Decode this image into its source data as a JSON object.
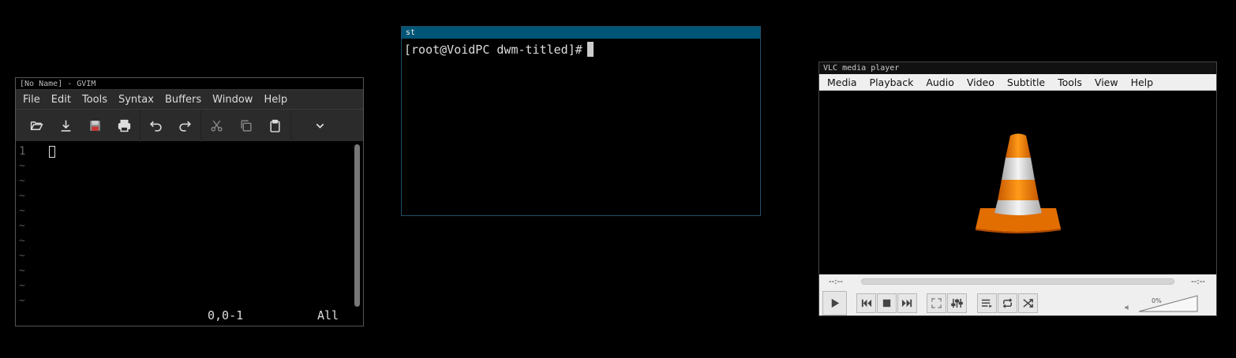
{
  "gvim": {
    "title": "[No Name] - GVIM",
    "menu": [
      "File",
      "Edit",
      "Tools",
      "Syntax",
      "Buffers",
      "Window",
      "Help"
    ],
    "line_number": "1",
    "tilde": "~",
    "position": "0,0-1",
    "scroll_label": "All"
  },
  "st": {
    "title": "st",
    "prompt": "[root@VoidPC dwm-titled]#"
  },
  "vlc": {
    "title": "VLC media player",
    "menu": [
      "Media",
      "Playback",
      "Audio",
      "Video",
      "Subtitle",
      "Tools",
      "View",
      "Help"
    ],
    "elapsed": "--:--",
    "remaining": "--:--",
    "volume": "0%",
    "seek_progress": 0
  },
  "colors": {
    "st_title_bg": "#005577",
    "vlc_cone_orange": "#f08a00"
  }
}
